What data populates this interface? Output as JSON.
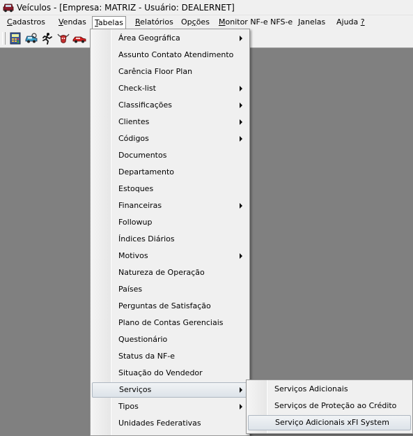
{
  "window": {
    "title": "Veículos - [Empresa: MATRIZ - Usuário: DEALERNET]"
  },
  "menubar": {
    "items": [
      {
        "label": "Cadastros",
        "underline": "C",
        "rest": "adastros"
      },
      {
        "label": "Vendas",
        "underline": "V",
        "rest": "endas"
      },
      {
        "label": "Tabelas",
        "underline": "T",
        "rest": "abelas"
      },
      {
        "label": "Relatórios",
        "underline": "R",
        "rest": "elatórios"
      },
      {
        "label": "Opções",
        "pre": "Op",
        "underline": "ç",
        "rest": "ões"
      },
      {
        "label": "Monitor NF-e NFS-e",
        "underline": "M",
        "rest": "onitor NF-e NFS-e"
      },
      {
        "label": "Janelas",
        "underline": "J",
        "rest": "anelas"
      },
      {
        "label": "Ajuda ?",
        "pre": "Ajuda ",
        "underline": "?",
        "rest": ""
      }
    ]
  },
  "toolbar": {
    "buttons": [
      "calculator-icon",
      "vehicle-search-icon",
      "runner-icon",
      "bull-icon",
      "red-car-icon"
    ]
  },
  "tabelas_menu": {
    "items": [
      {
        "label": "Área Geográfica",
        "submenu": true
      },
      {
        "label": "Assunto Contato Atendimento",
        "submenu": false
      },
      {
        "label": "Carência Floor Plan",
        "submenu": false
      },
      {
        "label": "Check-list",
        "submenu": true
      },
      {
        "label": "Classificações",
        "submenu": true
      },
      {
        "label": "Clientes",
        "submenu": true
      },
      {
        "label": "Códigos",
        "submenu": true
      },
      {
        "label": "Documentos",
        "submenu": false
      },
      {
        "label": "Departamento",
        "submenu": false
      },
      {
        "label": "Estoques",
        "submenu": false
      },
      {
        "label": "Financeiras",
        "submenu": true
      },
      {
        "label": "Followup",
        "submenu": false
      },
      {
        "label": "Índices Diários",
        "submenu": false
      },
      {
        "label": "Motivos",
        "submenu": true
      },
      {
        "label": "Natureza de Operação",
        "submenu": false
      },
      {
        "label": "Países",
        "submenu": false
      },
      {
        "label": "Perguntas de Satisfação",
        "submenu": false
      },
      {
        "label": "Plano de Contas Gerenciais",
        "submenu": false
      },
      {
        "label": "Questionário",
        "submenu": false
      },
      {
        "label": "Status da NF-e",
        "submenu": false
      },
      {
        "label": "Situação do Vendedor",
        "submenu": false
      },
      {
        "label": "Serviços",
        "submenu": true
      },
      {
        "label": "Tipos",
        "submenu": true
      },
      {
        "label": "Unidades Federativas",
        "submenu": false
      }
    ]
  },
  "servicos_submenu": {
    "items": [
      {
        "label": "Serviços Adicionais"
      },
      {
        "label": "Serviços de Proteção ao Crédito"
      },
      {
        "label": "Serviço Adicionais xFI System"
      }
    ]
  },
  "colors": {
    "workspace": "#808080",
    "menu_bg": "#f0f0f0",
    "highlight_border": "#aeb7c1"
  }
}
